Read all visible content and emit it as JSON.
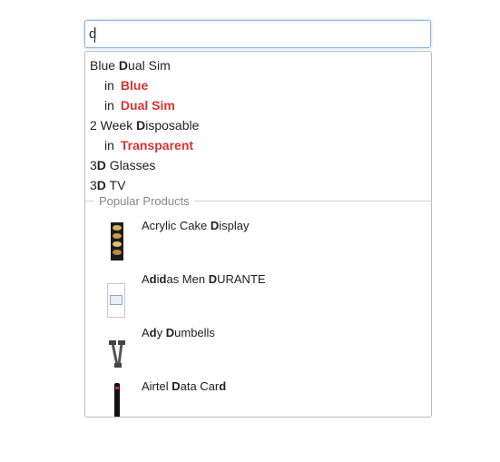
{
  "search": {
    "value": "d"
  },
  "suggestions": [
    {
      "parts": [
        [
          "",
          "Blue "
        ],
        [
          "hl",
          "D"
        ],
        [
          "",
          "ual Sim"
        ]
      ]
    },
    {
      "in": "in",
      "category": "Blue"
    },
    {
      "in": "in",
      "category": "Dual Sim"
    },
    {
      "parts": [
        [
          "",
          "2 Week "
        ],
        [
          "hl",
          "D"
        ],
        [
          "",
          "isposable"
        ]
      ]
    },
    {
      "in": "in",
      "category": "Transparent"
    },
    {
      "parts": [
        [
          "",
          "3"
        ],
        [
          "hl",
          "D"
        ],
        [
          "",
          " Glasses"
        ]
      ]
    },
    {
      "parts": [
        [
          "",
          "3"
        ],
        [
          "hl",
          "D"
        ],
        [
          "",
          " TV"
        ]
      ]
    }
  ],
  "popular_products": {
    "title": "Popular Products",
    "items": [
      {
        "name_parts": [
          [
            "",
            "Acrylic Cake "
          ],
          [
            "hl",
            "D"
          ],
          [
            "",
            "isplay"
          ]
        ],
        "icon": "cake-display-thumbnail"
      },
      {
        "name_parts": [
          [
            "",
            "A"
          ],
          [
            "hl",
            "d"
          ],
          [
            "",
            "i"
          ],
          [
            "hl",
            "d"
          ],
          [
            "",
            "as Men "
          ],
          [
            "hl",
            "D"
          ],
          [
            "",
            "URANTE"
          ]
        ],
        "icon": "broken-image-icon"
      },
      {
        "name_parts": [
          [
            "",
            "A"
          ],
          [
            "hl",
            "d"
          ],
          [
            "",
            "y "
          ],
          [
            "hl",
            "D"
          ],
          [
            "",
            "umbells"
          ]
        ],
        "icon": "dumbbell-thumbnail"
      },
      {
        "name_parts": [
          [
            "",
            "Airtel "
          ],
          [
            "hl",
            "D"
          ],
          [
            "",
            "ata Car"
          ],
          [
            "hl",
            "d"
          ]
        ],
        "icon": "data-card-thumbnail"
      }
    ]
  }
}
